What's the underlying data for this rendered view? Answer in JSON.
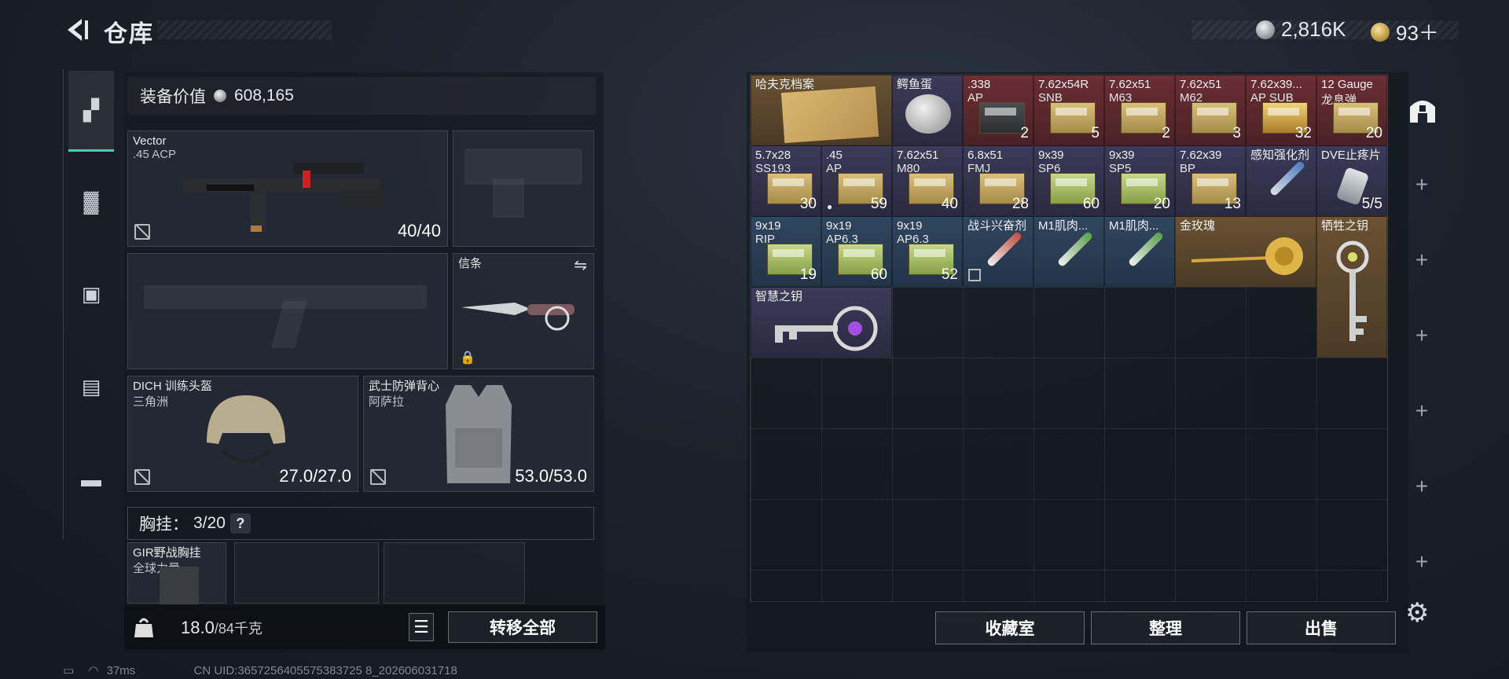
{
  "header": {
    "title": "仓库",
    "silver": "2,816K",
    "gold": "93＋"
  },
  "left": {
    "value_label": "装备价值",
    "value": "608,165",
    "primary": {
      "name": "Vector",
      "ammo": ".45 ACP",
      "count": "40/40"
    },
    "melee": {
      "name": "信条"
    },
    "helmet": {
      "name": "DICH 训练头盔",
      "origin": "三角洲",
      "durability": "27.0/27.0"
    },
    "armor": {
      "name": "武士防弹背心",
      "origin": "阿萨拉",
      "durability": "53.0/53.0"
    },
    "chest_label": "胸挂：",
    "chest_value": "3/20",
    "help": "?",
    "rig": {
      "name": "GIR野战胸挂",
      "origin": "全球力量"
    },
    "weight": "18.0",
    "weight_max": "/84千克",
    "transfer_all": "转移全部"
  },
  "grid_items": [
    {
      "label": "哈夫克档案",
      "sub": "",
      "count": ""
    },
    {
      "label": "鳄鱼蛋",
      "sub": "",
      "count": ""
    },
    {
      "label": ".338",
      "sub": "AP",
      "count": "2"
    },
    {
      "label": "7.62x54R",
      "sub": "SNB",
      "count": "5"
    },
    {
      "label": "7.62x51",
      "sub": "M63",
      "count": "2"
    },
    {
      "label": "7.62x51",
      "sub": "M62",
      "count": "3"
    },
    {
      "label": "7.62x39...",
      "sub": "AP SUB",
      "count": "32"
    },
    {
      "label": "12 Gauge",
      "sub": "龙息弹",
      "count": "20"
    },
    {
      "label": "5.7x28",
      "sub": "SS193",
      "count": "30"
    },
    {
      "label": ".45",
      "sub": "AP",
      "count": "59"
    },
    {
      "label": "7.62x51",
      "sub": "M80",
      "count": "40"
    },
    {
      "label": "6.8x51",
      "sub": "FMJ",
      "count": "28"
    },
    {
      "label": "9x39",
      "sub": "SP6",
      "count": "60"
    },
    {
      "label": "9x39",
      "sub": "SP5",
      "count": "20"
    },
    {
      "label": "7.62x39",
      "sub": "BP",
      "count": "13"
    },
    {
      "label": "感知强化剂",
      "sub": "",
      "count": ""
    },
    {
      "label": "DVE止疼片",
      "sub": "",
      "count": "5/5"
    },
    {
      "label": "9x19",
      "sub": "RIP",
      "count": "19"
    },
    {
      "label": "9x19",
      "sub": "AP6.3",
      "count": "60"
    },
    {
      "label": "9x19",
      "sub": "AP6.3",
      "count": "52"
    },
    {
      "label": "战斗兴奋剂",
      "sub": "",
      "count": ""
    },
    {
      "label": "M1肌肉...",
      "sub": "",
      "count": ""
    },
    {
      "label": "M1肌肉...",
      "sub": "",
      "count": ""
    },
    {
      "label": "金玫瑰",
      "sub": "",
      "count": ""
    },
    {
      "label": "牺牲之钥",
      "sub": "",
      "count": ""
    },
    {
      "label": "智慧之钥",
      "sub": "",
      "count": ""
    }
  ],
  "buttons": {
    "collection": "收藏室",
    "organize": "整理",
    "sell": "出售"
  },
  "status": {
    "ping": "37ms",
    "uid": "CN UID:3657256405575383725 8_202606031718"
  }
}
